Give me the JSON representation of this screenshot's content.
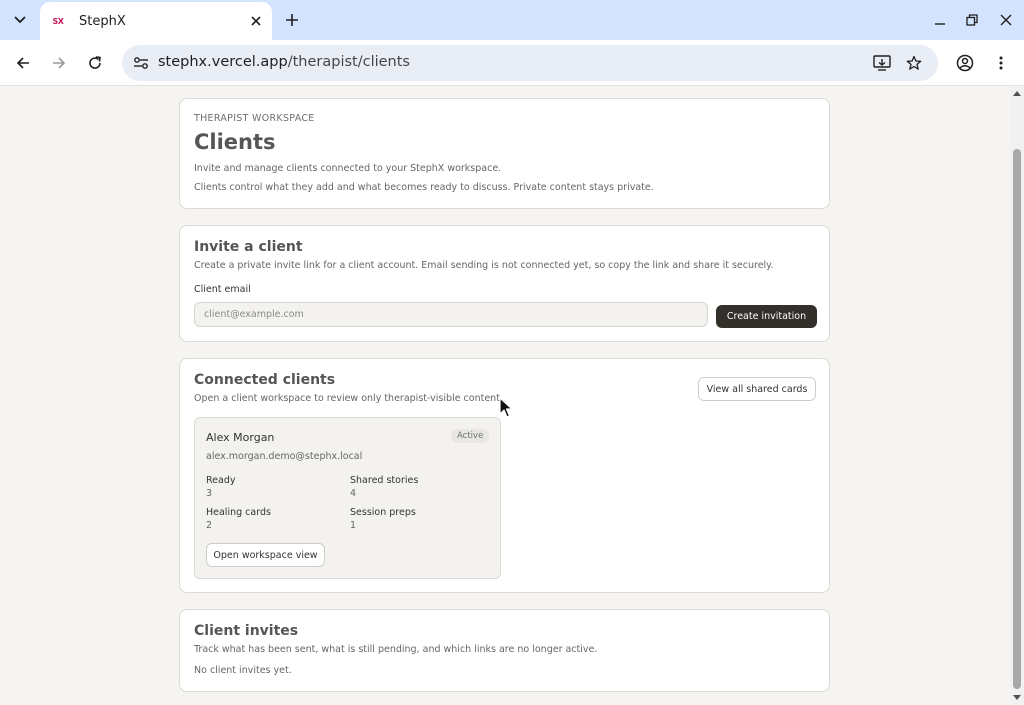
{
  "browser": {
    "tab_title": "StephX",
    "favicon_text": "SX",
    "url_host": "stephx.vercel.app",
    "url_path": "/therapist/clients"
  },
  "header": {
    "eyebrow": "THERAPIST WORKSPACE",
    "title": "Clients",
    "desc1": "Invite and manage clients connected to your StephX workspace.",
    "desc2": "Clients control what they add and what becomes ready to discuss. Private content stays private."
  },
  "invite": {
    "title": "Invite a client",
    "desc": "Create a private invite link for a client account. Email sending is not connected yet, so copy the link and share it securely.",
    "email_label": "Client email",
    "email_placeholder": "client@example.com",
    "email_value": "",
    "button": "Create invitation"
  },
  "connected": {
    "title": "Connected clients",
    "desc": "Open a client workspace to review only therapist-visible content.",
    "view_all": "View all shared cards",
    "client": {
      "name": "Alex Morgan",
      "email": "alex.morgan.demo@stephx.local",
      "status": "Active",
      "stats": [
        {
          "label": "Ready",
          "value": "3"
        },
        {
          "label": "Shared stories",
          "value": "4"
        },
        {
          "label": "Healing cards",
          "value": "2"
        },
        {
          "label": "Session preps",
          "value": "1"
        }
      ],
      "open_button": "Open workspace view"
    }
  },
  "invites": {
    "title": "Client invites",
    "desc": "Track what has been sent, what is still pending, and which links are no longer active.",
    "empty": "No client invites yet."
  },
  "colors": {
    "page_bg": "#f5f4f1",
    "tabbar_bg": "#d3e3fd",
    "primary_button": "#33302b",
    "favicon": "#c2185b"
  },
  "icons": [
    "tab-dropdown-icon",
    "close-icon",
    "plus-icon",
    "minimize-icon",
    "restore-icon",
    "back-icon",
    "forward-icon",
    "reload-icon",
    "site-info-icon",
    "install-icon",
    "star-icon",
    "profile-icon",
    "menu-icon"
  ]
}
